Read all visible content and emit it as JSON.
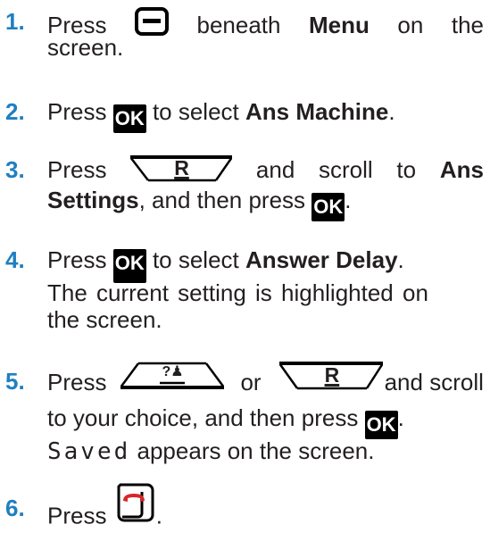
{
  "steps": [
    {
      "number": "1.",
      "text_press": "Press",
      "text_beneath": "beneath",
      "bold_menu": "Menu",
      "text_on": "on",
      "text_the": "the",
      "line2": "screen.",
      "icon": "soft-key-minus-icon"
    },
    {
      "number": "2.",
      "text_press": "Press",
      "ok_label": "OK",
      "text_mid": "to select",
      "bold": "Ans Machine",
      "text_end": "."
    },
    {
      "number": "3.",
      "text_press": "Press",
      "key_label": "R",
      "text_and": "and",
      "text_scroll": "scroll",
      "text_to": "to",
      "bold_ans": "Ans",
      "bold_settings": "Settings",
      "text_then": ", and then press",
      "ok_label": "OK",
      "text_end": "."
    },
    {
      "number": "4.",
      "text_press": "Press",
      "ok_label": "OK",
      "text_mid": "to select",
      "bold": "Answer Delay",
      "text_end": ".",
      "note_line1": "The current setting is highlighted on",
      "note_line2": "the screen."
    },
    {
      "number": "5.",
      "text_press": "Press",
      "key_left_label": "?♟",
      "text_or": "or",
      "key_right_label": "R",
      "text_and_scroll": "and scroll",
      "line2": "to your choice, and then press",
      "ok_label": "OK",
      "text_end": ".",
      "saved_word": "Saved",
      "saved_rest": "appears on the screen."
    },
    {
      "number": "6.",
      "text_press": "Press",
      "icon": "end-call-key-icon",
      "text_end": "."
    }
  ],
  "colors": {
    "step_number": "#1f7fc1",
    "text": "#231f20",
    "ok_bg": "#000000"
  }
}
